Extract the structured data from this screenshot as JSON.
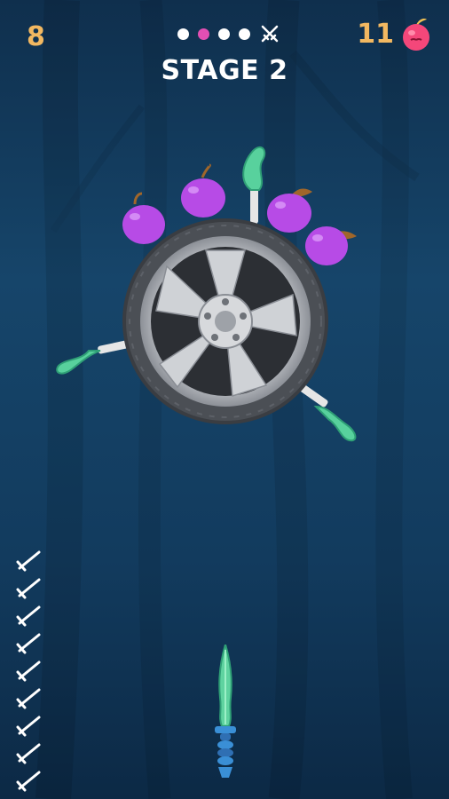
{
  "hud": {
    "score": "8",
    "apple_count": "11",
    "stage_label": "STAGE 2",
    "stage_progress": {
      "total_stages": 5,
      "current_stage": 2,
      "final_stage_icon": "crossed-swords-icon"
    }
  },
  "board": {
    "type": "wheel",
    "stuck_knives": 3,
    "apples_on_board": 4
  },
  "knives_remaining": 9,
  "colors": {
    "score": "#f2b861",
    "active_dot": "#e24fb3",
    "apple": "#b74be6",
    "knife_blade": "#5fd3a0",
    "knife_handle": "#3a8fd6"
  }
}
